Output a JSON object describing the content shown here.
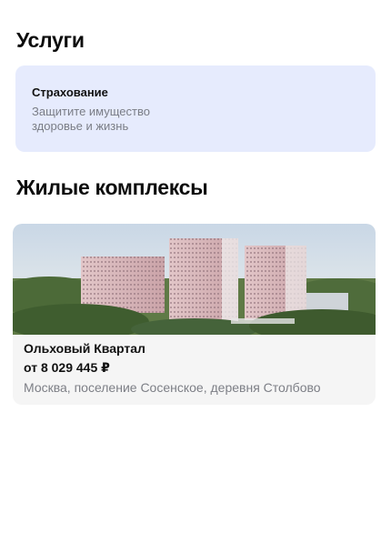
{
  "services": {
    "title": "Услуги",
    "card": {
      "title": "Страхование",
      "description": "Защитите имущество здоровье и жизнь",
      "background": "#e6ebfd"
    }
  },
  "complexes": {
    "title": "Жилые комплексы",
    "items": [
      {
        "name": "Ольховый Квартал",
        "price": "от 8 029 445 ₽",
        "address": "Москва, поселение Сосенское, деревня Столбово",
        "photo": "residential-towers-photo"
      }
    ]
  }
}
